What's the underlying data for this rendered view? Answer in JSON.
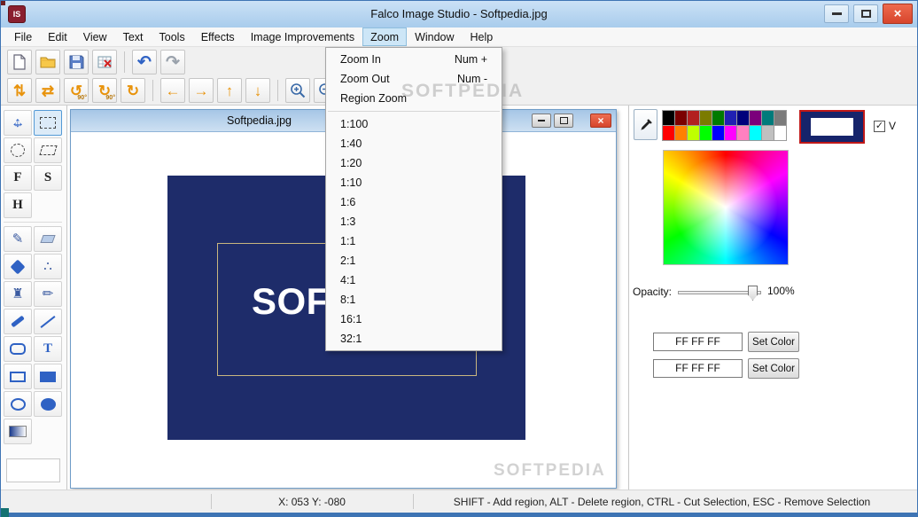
{
  "window": {
    "title": "Falco Image Studio - Softpedia.jpg"
  },
  "menu_bar": {
    "items": [
      "File",
      "Edit",
      "View",
      "Text",
      "Tools",
      "Effects",
      "Image Improvements",
      "Zoom",
      "Window",
      "Help"
    ]
  },
  "zoom_menu": {
    "items": [
      {
        "label": "Zoom In",
        "shortcut": "Num +"
      },
      {
        "label": "Zoom Out",
        "shortcut": "Num -"
      },
      {
        "label": "Region Zoom",
        "shortcut": ""
      }
    ],
    "ratios": [
      "1:100",
      "1:40",
      "1:20",
      "1:10",
      "1:6",
      "1:3",
      "1:1",
      "2:1",
      "4:1",
      "8:1",
      "16:1",
      "32:1"
    ]
  },
  "icons": {
    "app_monogram": "IS",
    "close": "×",
    "check": "✓",
    "undo": "↶",
    "redo": "↷",
    "flip_vertical": "⇅",
    "flip_horizontal": "⇄",
    "rotate_left": "↺",
    "rotate_right": "↻",
    "degrees": "90°",
    "arrow_left": "←",
    "arrow_right": "→",
    "arrow_up": "↑",
    "arrow_down": "↓",
    "move_h": "↔",
    "move_v": "↕",
    "pen": "✎",
    "pencil": "✏",
    "spray": "∴",
    "stamp": "♜",
    "letter_f": "F",
    "letter_s": "S",
    "letter_h": "H",
    "letter_t": "T"
  },
  "document_window": {
    "title": "Softpedia.jpg",
    "logo_text": "SOFT"
  },
  "canvas": {
    "image_bg": "#1e2c6a",
    "selection_color": "#c9b67f"
  },
  "right_panel": {
    "opacity_label": "Opacity:",
    "opacity_value": "100%",
    "overlay_checkbox_label": "V",
    "color_value_1": "FF FF FF",
    "set_color_1": "Set Color",
    "color_value_2": "FF FF FF",
    "set_color_2": "Set Color",
    "palette_row1": [
      "#000000",
      "#7b0000",
      "#b22020",
      "#7b7b00",
      "#007b00",
      "#2020b2",
      "#00007b",
      "#7b007b",
      "#007b7b",
      "#7b7b7b"
    ],
    "palette_row2": [
      "#ff0000",
      "#ff8000",
      "#bfff00",
      "#00ff00",
      "#0000ff",
      "#ff00ff",
      "#ff80c0",
      "#00ffff",
      "#c0c0c0",
      "#ffffff"
    ]
  },
  "status_bar": {
    "coordinates": "X: 053 Y: -080",
    "hint": "SHIFT - Add region, ALT - Delete region, CTRL - Cut Selection, ESC - Remove Selection"
  },
  "watermark": {
    "text": "SOFTPEDIA"
  }
}
